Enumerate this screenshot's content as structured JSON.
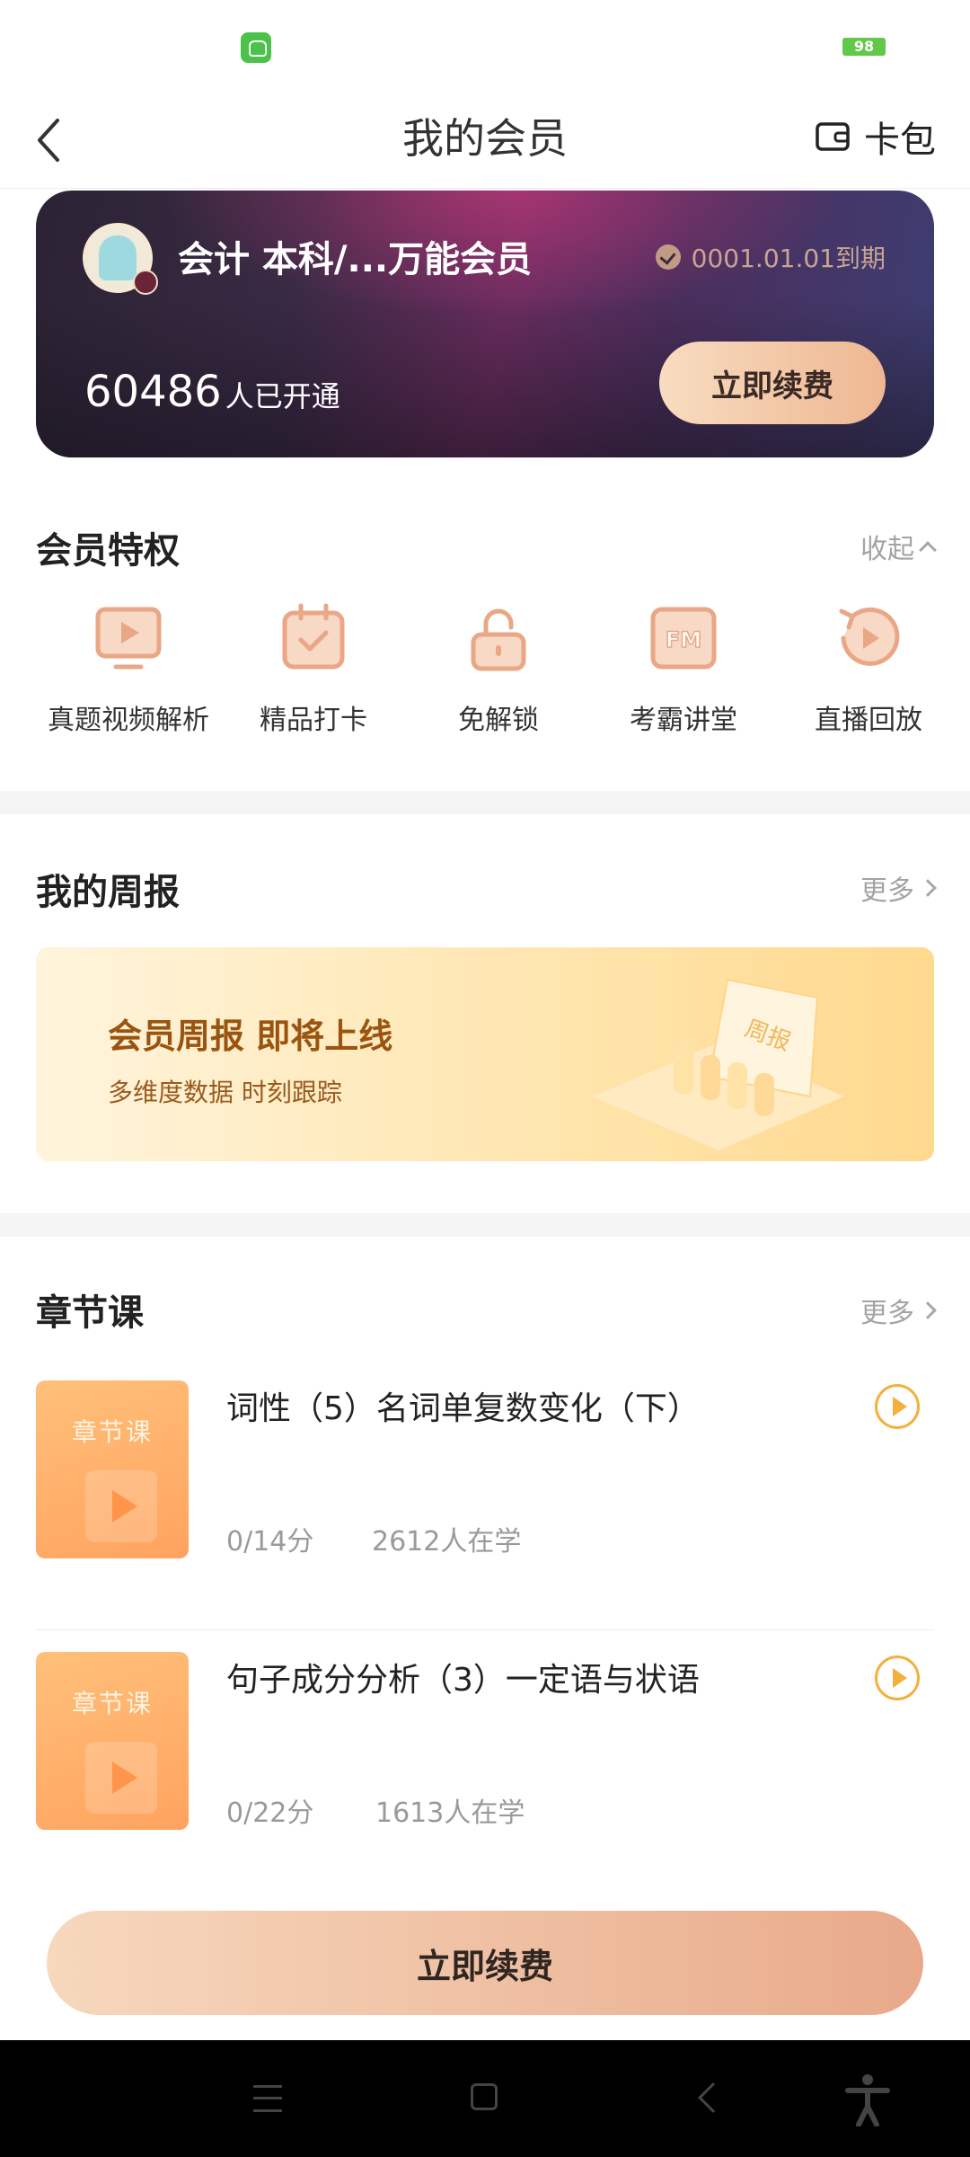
{
  "status_bar": {
    "battery": "98"
  },
  "header": {
    "title": "我的会员",
    "wallet_label": "卡包"
  },
  "member_card": {
    "name": "会计 本科/...万能会员",
    "expiry": "0001.01.01到期",
    "opened_count": "60486",
    "opened_label": "人已开通",
    "renew_label": "立即续费"
  },
  "privileges": {
    "title": "会员特权",
    "collapse_label": "收起",
    "items": [
      {
        "label": "真题视频解析",
        "icon": "video-screen-icon"
      },
      {
        "label": "精品打卡",
        "icon": "calendar-check-icon"
      },
      {
        "label": "免解锁",
        "icon": "unlock-icon"
      },
      {
        "label": "考霸讲堂",
        "icon": "fm-radio-icon"
      },
      {
        "label": "直播回放",
        "icon": "replay-icon"
      }
    ]
  },
  "weekly": {
    "title": "我的周报",
    "more_label": "更多",
    "banner_title": "会员周报 即将上线",
    "banner_subtitle": "多维度数据 时刻跟踪",
    "banner_badge": "周报"
  },
  "chapters": {
    "title": "章节课",
    "more_label": "更多",
    "items": [
      {
        "thumb_label": "章节课",
        "title": "词性（5）名词单复数变化（下）",
        "progress": "0/14分",
        "learners": "2612人在学"
      },
      {
        "thumb_label": "章节课",
        "title": "句子成分分析（3）一定语与状语",
        "progress": "0/22分",
        "learners": "1613人在学"
      }
    ]
  },
  "bottom": {
    "renew_label": "立即续费"
  },
  "colors": {
    "accent_orange": "#f4b03c",
    "privilege_icon": "#e9a786",
    "renew_gradient_start": "#f7d8bd",
    "renew_gradient_end": "#e8a98a"
  }
}
